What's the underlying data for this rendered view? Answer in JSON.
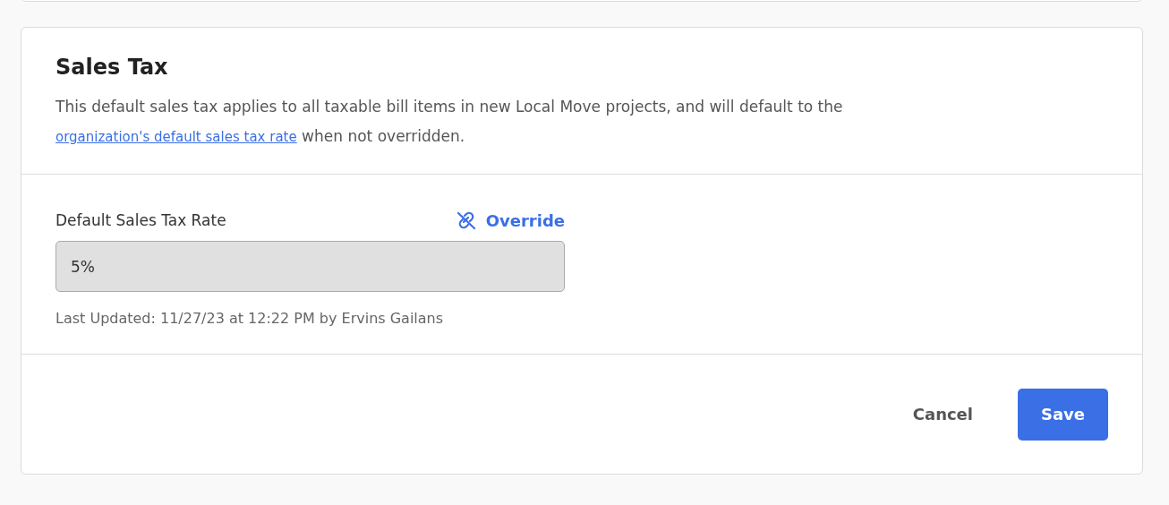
{
  "section": {
    "title": "Sales Tax",
    "description_start": "This default sales tax applies to all taxable bill items in new Local Move projects, and will default to the",
    "description_link": "organization's default sales tax rate",
    "description_end": "when not overridden."
  },
  "field": {
    "label": "Default Sales Tax Rate",
    "action": "Override",
    "value": "5%",
    "disabled": true,
    "note": "Last Updated: 11/27/23 at 12:22 PM by Ervins Gailans"
  },
  "buttons": {
    "cancel": "Cancel",
    "save": "Save"
  }
}
